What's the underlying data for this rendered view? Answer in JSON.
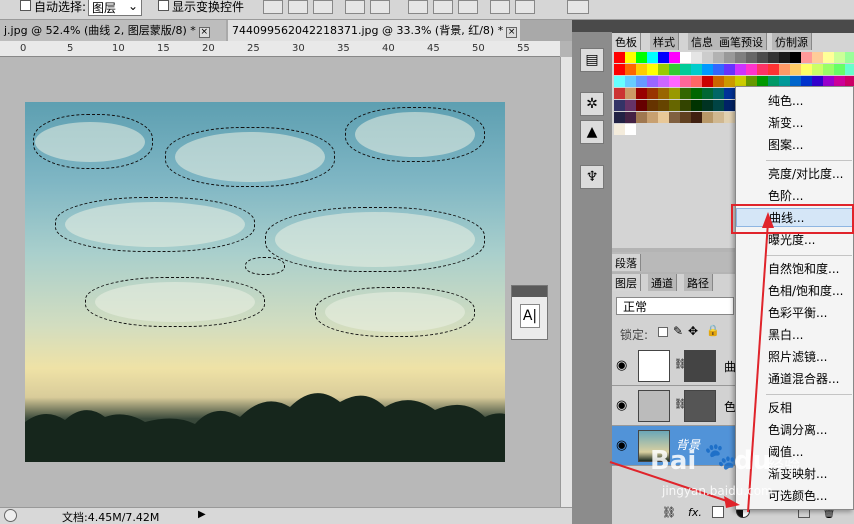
{
  "options_bar": {
    "auto_select_label": "自动选择:",
    "auto_select_value": "图层",
    "show_transform_label": "显示变换控件"
  },
  "doc_tabs": [
    {
      "label": "j.jpg @ 52.4% (曲线 2, 图层蒙版/8) *"
    },
    {
      "label": "744099562042218371.jpg @ 33.3% (背景, 红/8) *"
    }
  ],
  "ruler": {
    "ticks": [
      "0",
      "5",
      "10",
      "15",
      "20",
      "25",
      "30",
      "35",
      "40",
      "45",
      "50",
      "55"
    ]
  },
  "status": {
    "zoom_icon": "zoom-icon",
    "doc_info": "文档:4.45M/7.42M"
  },
  "char_panel": {
    "glyph": "A|"
  },
  "swatch_panel": {
    "tabs": [
      "色板",
      "样式",
      "信息",
      "画笔预设",
      "仿制源"
    ],
    "colors": [
      "#ff0000",
      "#ffff00",
      "#00ff00",
      "#00ffff",
      "#0000ff",
      "#ff00ff",
      "#ffffff",
      "#e5e5e5",
      "#cccccc",
      "#b2b2b2",
      "#999999",
      "#7f7f7f",
      "#666666",
      "#4c4c4c",
      "#333333",
      "#191919",
      "#000000",
      "#ff9999",
      "#ffcc99",
      "#ffff99",
      "#ccff99",
      "#99ff99",
      "#ff0000",
      "#ff6600",
      "#ffcc00",
      "#ffff00",
      "#99cc00",
      "#33cc33",
      "#00cc99",
      "#00cccc",
      "#0099ff",
      "#3366ff",
      "#6633ff",
      "#cc33ff",
      "#ff33cc",
      "#ff3366",
      "#ff3333",
      "#ff9966",
      "#ffcc66",
      "#ffff66",
      "#ccff66",
      "#99ff66",
      "#66ff66",
      "#66ffcc",
      "#66ffff",
      "#66ccff",
      "#6699ff",
      "#9966ff",
      "#cc66ff",
      "#ff66ff",
      "#ff6699",
      "#ff6666",
      "#cc0000",
      "#cc6600",
      "#cc9900",
      "#cccc00",
      "#669900",
      "#009900",
      "#009966",
      "#009999",
      "#0066cc",
      "#0033cc",
      "#3300cc",
      "#9900cc",
      "#cc0099",
      "#cc0066",
      "#cc3333",
      "#cc9966",
      "#990000",
      "#993300",
      "#996600",
      "#999900",
      "#336600",
      "#006600",
      "#006633",
      "#006666",
      "#003399",
      "#000099",
      "#330099",
      "#660099",
      "#990066",
      "#990033",
      "#993333",
      "#996633",
      "#999966",
      "#669966",
      "#339966",
      "#336666",
      "#333366",
      "#663366",
      "#660000",
      "#663300",
      "#664400",
      "#666600",
      "#334400",
      "#003300",
      "#003322",
      "#004444",
      "#002266",
      "#000066",
      "#220066",
      "#440066",
      "#660044",
      "#660022",
      "#663333",
      "#664422",
      "#666644",
      "#446644",
      "#226644",
      "#224444",
      "#222244",
      "#442244",
      "#a07850",
      "#c8a070",
      "#e8c898",
      "#806040",
      "#604020",
      "#402010",
      "#b89868",
      "#d0b890",
      "#e0d0b0",
      "#f0e8d0",
      "#8c6c4c",
      "#5c3c1c",
      "#b0b0b0",
      "#909090",
      "#707070",
      "#505050",
      "#303030",
      "#c0a080",
      "#d8c0a0",
      "#e8d8c0",
      "#f4ecdc",
      "#ffffff"
    ]
  },
  "para_panel": {
    "title": "段落"
  },
  "layers_panel": {
    "tabs": [
      "图层",
      "通道",
      "路径"
    ],
    "blend_mode": "正常",
    "lock_label": "锁定:",
    "layers": [
      {
        "name": "曲",
        "icon": "curves-adjustment-icon"
      },
      {
        "name": "色",
        "icon": "levels-adjustment-icon"
      },
      {
        "name": "背景",
        "icon": "background-icon"
      }
    ]
  },
  "adjust_menu": {
    "items": [
      "纯色...",
      "渐变...",
      "图案...",
      "亮度/对比度...",
      "色阶...",
      "曲线...",
      "曝光度...",
      "自然饱和度...",
      "色相/饱和度...",
      "色彩平衡...",
      "黑白...",
      "照片滤镜...",
      "通道混合器...",
      "反相",
      "色调分离...",
      "阈值...",
      "渐变映射...",
      "可选颜色..."
    ],
    "highlighted": "曲线..."
  },
  "watermark": {
    "brand": "Bai",
    "du": "du",
    "paw": "🐾",
    "suffix": "经验",
    "url": "jingyan.baidu.com"
  },
  "colors": {
    "accent_red": "#e0242b",
    "selection_blue": "#5193d8"
  }
}
